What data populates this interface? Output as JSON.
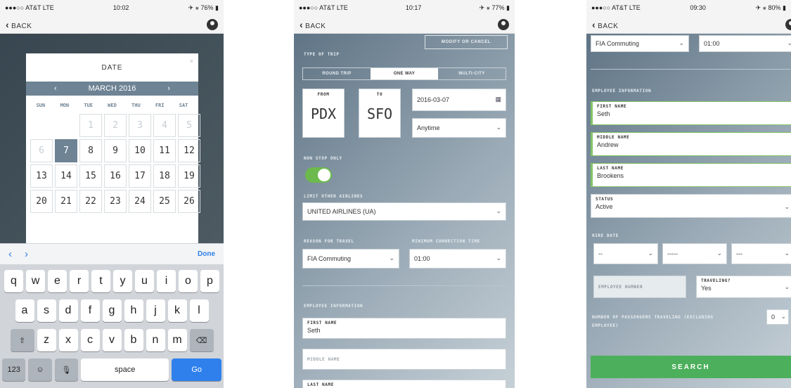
{
  "phone1": {
    "status": {
      "carrier": "●●●○○ AT&T  LTE",
      "time": "10:02",
      "battery": "✈ ⚹ 76% ▮"
    },
    "nav": {
      "back": "BACK",
      "account_icon": "account-icon"
    },
    "date_picker": {
      "title": "DATE",
      "close": "×",
      "prev": "‹",
      "next": "›",
      "month": "MARCH 2016",
      "weekdays": [
        "SUN",
        "MON",
        "TUE",
        "WED",
        "THU",
        "FRI",
        "SAT"
      ],
      "weeks": [
        [
          "",
          "",
          "1",
          "2",
          "3",
          "4",
          "5"
        ],
        [
          "6",
          "7",
          "8",
          "9",
          "10",
          "11",
          "12"
        ],
        [
          "13",
          "14",
          "15",
          "16",
          "17",
          "18",
          "19"
        ],
        [
          "20",
          "21",
          "22",
          "23",
          "24",
          "25",
          "26"
        ]
      ],
      "selected": "7"
    },
    "keyboard": {
      "prev": "‹",
      "next": "›",
      "done": "Done",
      "row1": [
        "q",
        "w",
        "e",
        "r",
        "t",
        "y",
        "u",
        "i",
        "o",
        "p"
      ],
      "row2": [
        "a",
        "s",
        "d",
        "f",
        "g",
        "h",
        "j",
        "k",
        "l"
      ],
      "row3": [
        "⇧",
        "z",
        "x",
        "c",
        "v",
        "b",
        "n",
        "m",
        "⌫"
      ],
      "numbers": "123",
      "emoji": "☺",
      "mic": "🎙",
      "space": "space",
      "go": "Go"
    }
  },
  "phone2": {
    "status": {
      "carrier": "●●●○○ AT&T  LTE",
      "time": "10:17",
      "battery": "✈ ⚹ 77% ▮"
    },
    "nav": {
      "back": "BACK"
    },
    "modify_button": "MODIFY OR CANCEL",
    "type_of_trip_label": "TYPE OF TRIP",
    "tabs": [
      "ROUND TRIP",
      "ONE WAY",
      "MULTI-CITY"
    ],
    "from": {
      "label": "FROM",
      "code": "PDX"
    },
    "to": {
      "label": "TO",
      "code": "SFO"
    },
    "date_value": "2016-03-07",
    "time_value": "Anytime",
    "non_stop_label": "NON STOP ONLY",
    "limit_airlines_label": "LIMIT OTHER AIRLINES",
    "airline_value": "UNITED AIRLINES (UA)",
    "reason_label": "REASON FOR TRAVEL",
    "reason_value": "FIA Commuting",
    "min_conn_label": "MINIMUM CONNECTION TIME",
    "min_conn_value": "01:00",
    "employee_info_label": "EMPLOYEE INFORMATION",
    "first_name_label": "FIRST NAME",
    "first_name_value": "Seth",
    "middle_name_placeholder": "MIDDLE NAME",
    "last_name_label": "LAST NAME"
  },
  "phone3": {
    "status": {
      "carrier": "●●●○○ AT&T  LTE",
      "time": "09:30",
      "battery": "✈ ⚹ 80% ▮"
    },
    "nav": {
      "back": "BACK"
    },
    "reason_value": "FIA Commuting",
    "min_conn_value": "01:00",
    "employee_info_label": "EMPLOYEE INFORMATION",
    "first_name_label": "FIRST NAME",
    "first_name_value": "Seth",
    "middle_name_label": "MIDDLE NAME",
    "middle_name_value": "Andrew",
    "last_name_label": "LAST NAME",
    "last_name_value": "Brookens",
    "status_label": "STATUS",
    "status_value": "Active",
    "hire_date_label": "HIRE DATE",
    "hire_month": "--",
    "hire_day": "-----",
    "hire_year": "---",
    "employee_number_placeholder": "EMPLOYEE NUMBER",
    "traveling_label": "TRAVELING?",
    "traveling_value": "Yes",
    "passengers_label": "NUMBER OF PASSENGERS TRAVELING (EXCLUDING EMPLOYEE)",
    "passengers_value": "0",
    "search_button": "SEARCH"
  }
}
